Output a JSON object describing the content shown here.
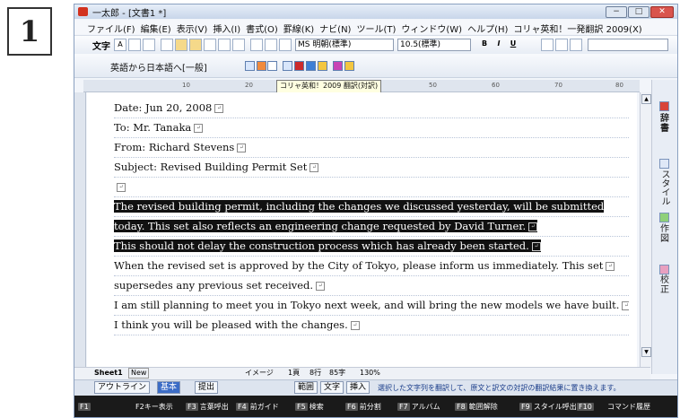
{
  "step": {
    "number": "1"
  },
  "window": {
    "title": "一太郎 - [文書1 *]",
    "min": "−",
    "max": "□",
    "close": "✕"
  },
  "menu": [
    "ファイル(F)",
    "編集(E)",
    "表示(V)",
    "挿入(I)",
    "書式(O)",
    "罫線(K)",
    "ナビ(N)",
    "ツール(T)",
    "ウィンドウ(W)",
    "ヘルプ(H)",
    "コリャ英和！一発翻訳 2009(X)"
  ],
  "toolbar": {
    "style_label": "文字",
    "font_name": "MS 明朝(標準)",
    "font_size": "10.5(標準)",
    "bold": "B",
    "italic": "I",
    "underline": "U"
  },
  "translate_toolbar": {
    "mode_label": "英語から日本語へ[一般]",
    "tooltip": "コリャ英和！2009 翻訳(対訳)"
  },
  "ruler": {
    "ticks": [
      "10",
      "20",
      "50",
      "60",
      "70",
      "80"
    ]
  },
  "document": {
    "lines": [
      {
        "text": "Date: Jun 20, 2008",
        "highlight": false
      },
      {
        "text": "To: Mr. Tanaka",
        "highlight": false
      },
      {
        "text": "From: Richard Stevens",
        "highlight": false
      },
      {
        "text": "Subject: Revised Building Permit Set",
        "highlight": false
      },
      {
        "text": "",
        "highlight": false
      },
      {
        "text": "The revised building permit, including the changes we discussed yesterday, will be submitted",
        "highlight": true
      },
      {
        "text": "today. This set also reflects an engineering change requested by David Turner.",
        "highlight": true
      },
      {
        "text": "This should not delay the construction process which has already been started.",
        "highlight": true
      },
      {
        "text": "When the revised set is approved by the City of Tokyo, please inform us immediately. This set",
        "highlight": false
      },
      {
        "text": "supersedes any previous set received.",
        "highlight": false
      },
      {
        "text": "I am still planning to meet you in Tokyo next week, and will bring the new models we have built.",
        "highlight": false
      },
      {
        "text": "I think you will be pleased with the changes.",
        "highlight": false
      }
    ]
  },
  "side_panel": {
    "dictionary": "辞書",
    "style": "スタイル",
    "drawing": "作図",
    "proofread": "校正"
  },
  "status": {
    "sheet": "Sheet1",
    "new_tab": "New",
    "image_mode": "イメージ",
    "page": "1頁",
    "line": "8行",
    "column": "85字",
    "zoom": "130%"
  },
  "view_tabs": {
    "outline": "アウトライン",
    "basic": "基本",
    "submit": "提出",
    "range": "範囲",
    "char": "文字",
    "insert": "挿入",
    "hint": "選択した文字列を翻訳して、原文と訳文の対訳の翻訳結果に置き換えます。"
  },
  "fkeys": [
    {
      "key": "F1",
      "label": ""
    },
    {
      "key": "F2",
      "label": "F2キー表示"
    },
    {
      "key": "F3",
      "label": "言葉呼出"
    },
    {
      "key": "F4",
      "label": "前ガイド"
    },
    {
      "key": "F5",
      "label": "検索"
    },
    {
      "key": "F6",
      "label": "前分割"
    },
    {
      "key": "F7",
      "label": "アルバム"
    },
    {
      "key": "F8",
      "label": "範囲解除"
    },
    {
      "key": "F9",
      "label": "スタイル呼出"
    },
    {
      "key": "F10",
      "label": ""
    },
    {
      "key": "F11",
      "label": "コマンド履歴"
    }
  ]
}
